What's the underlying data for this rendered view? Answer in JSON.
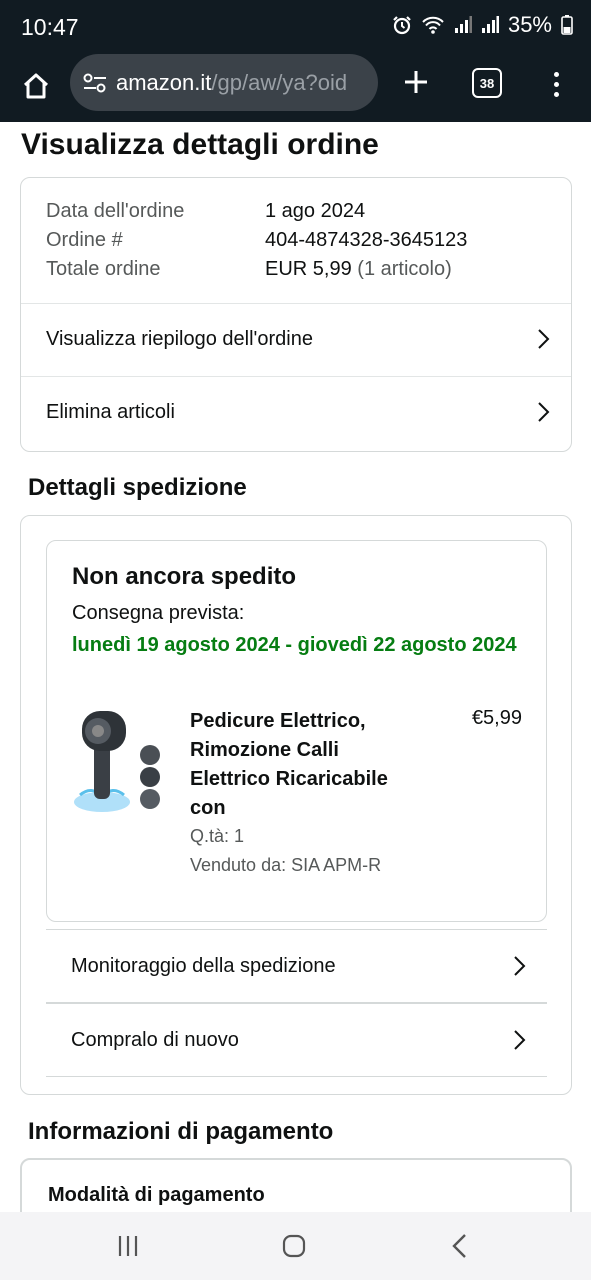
{
  "status_bar": {
    "time": "10:47",
    "battery": "35%"
  },
  "browser": {
    "url_domain": "amazon.it",
    "url_path": "/gp/aw/ya?oid",
    "tab_count": "38"
  },
  "page": {
    "title": "Visualizza dettagli ordine"
  },
  "order_summary": {
    "rows": [
      {
        "label": "Data dell'ordine",
        "value": "1 ago 2024"
      },
      {
        "label": "Ordine #",
        "value": "404-4874328-3645123"
      },
      {
        "label": "Totale ordine",
        "value": "EUR 5,99",
        "extra": "(1 articolo)"
      }
    ],
    "links": [
      "Visualizza riepilogo dell'ordine",
      "Elimina articoli"
    ]
  },
  "shipping": {
    "section_title": "Dettagli spedizione",
    "status": "Non ancora spedito",
    "delivery_label": "Consegna prevista:",
    "delivery_date": "lunedì 19 agosto 2024 - giovedì 22 agosto 2024",
    "product": {
      "title": "Pedicure Elettrico, Rimozione Calli Elettrico Ricaricabile con",
      "price": "€5,99",
      "qty": "Q.tà: 1",
      "seller": "Venduto da: SIA APM-R"
    },
    "links": [
      "Monitoraggio della spedizione",
      "Compralo di nuovo"
    ]
  },
  "payment": {
    "section_title": "Informazioni di pagamento",
    "method_label": "Modalità di pagamento"
  },
  "colors": {
    "delivery_green": "#067d12",
    "chrome_dark": "#111b22",
    "url_box": "#3b4249"
  }
}
